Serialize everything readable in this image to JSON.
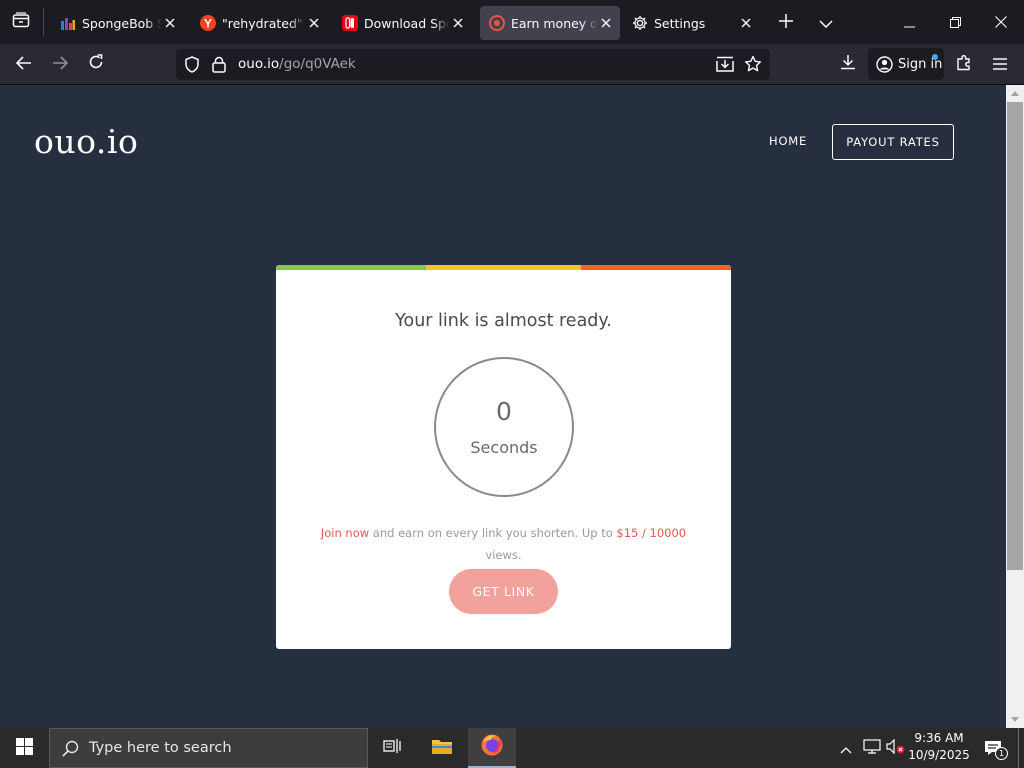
{
  "browser": {
    "tabs": [
      {
        "title": "SpongeBob Squarepants",
        "favicon": "tv-logo-icon",
        "active": false
      },
      {
        "title": "\"rehydrated\" \"nsp\"",
        "favicon": "yandex-icon",
        "active": false
      },
      {
        "title": "Download SpongeBob",
        "favicon": "switch-console-icon",
        "active": false
      },
      {
        "title": "Earn money on short links",
        "favicon": "ouo-target-icon",
        "active": true
      },
      {
        "title": "Settings",
        "favicon": "gear-icon",
        "active": false
      }
    ],
    "url_host": "ouo.io",
    "url_path": "/go/q0VAek",
    "signin_label": "Sign in"
  },
  "site": {
    "logo": "ouo.io",
    "nav": {
      "home": "HOME",
      "payout": "PAYOUT RATES"
    }
  },
  "card": {
    "title": "Your link is almost ready.",
    "countdown_value": "0",
    "countdown_unit": "Seconds",
    "promo_link": "Join now",
    "promo_text": " and earn on every link you shorten. Up to ",
    "promo_rate": "$15 / 10000",
    "promo_suffix": " views.",
    "button_label": "GET LINK",
    "stripe_colors": [
      "#8bc43f",
      "#f5c518",
      "#f26522"
    ]
  },
  "taskbar": {
    "search_placeholder": "Type here to search",
    "time": "9:36 AM",
    "date": "10/9/2025",
    "notification_count": "1"
  },
  "colors": {
    "page_bg": "#262f3f",
    "accent_red": "#e05a4f",
    "button_bg": "#f2a29c"
  }
}
